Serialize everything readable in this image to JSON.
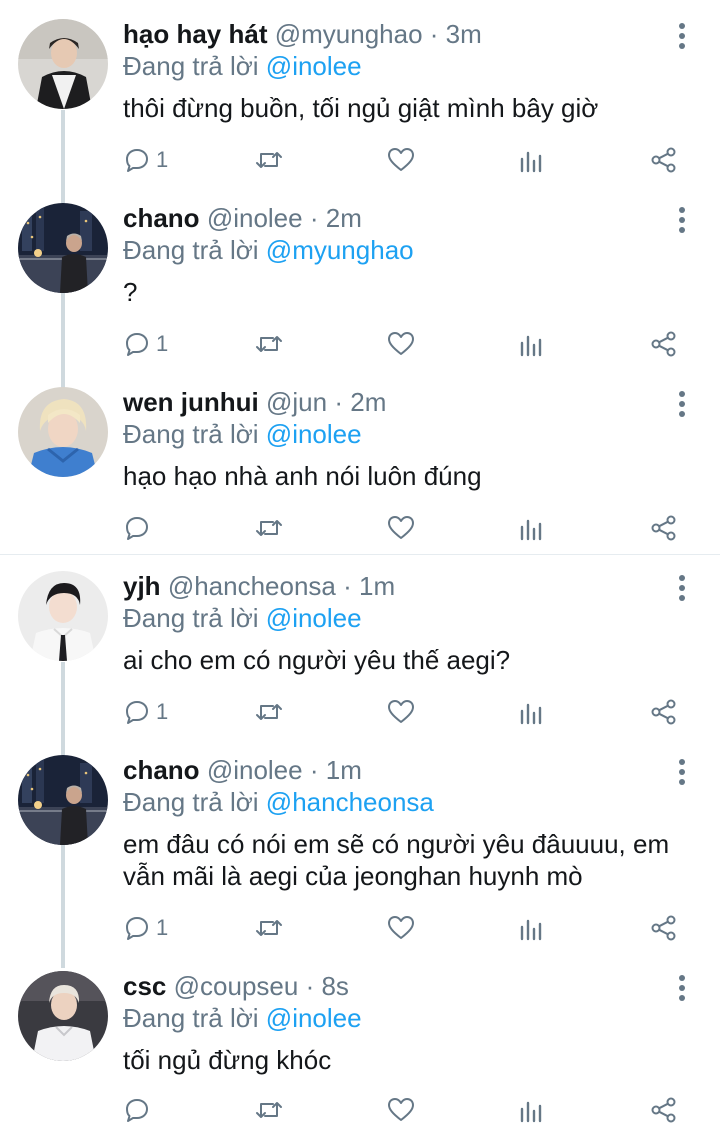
{
  "reply_prefix": "Đang trả lời",
  "tweets": [
    {
      "name": "hạo hay hát",
      "handle": "@myunghao",
      "time": "3m",
      "reply_to": "@inolee",
      "text": "thôi đừng buồn, tối ngủ giật mình bây giờ",
      "reply_count": "1"
    },
    {
      "name": "chano",
      "handle": "@inolee",
      "time": "2m",
      "reply_to": "@myunghao",
      "text": "?",
      "reply_count": "1"
    },
    {
      "name": "wen junhui",
      "handle": "@jun",
      "time": "2m",
      "reply_to": "@inolee",
      "text": "hạo hạo nhà anh nói luôn đúng",
      "reply_count": ""
    },
    {
      "name": "yjh",
      "handle": "@hancheonsa",
      "time": "1m",
      "reply_to": "@inolee",
      "text": "ai cho em có người yêu thế aegi?",
      "reply_count": "1"
    },
    {
      "name": "chano",
      "handle": "@inolee",
      "time": "1m",
      "reply_to": "@hancheonsa",
      "text": "em đâu có nói em sẽ có người yêu đâuuuu, em vẫn mãi là aegi của jeonghan huynh mò",
      "reply_count": "1"
    },
    {
      "name": "csc",
      "handle": "@coupseu",
      "time": "8s",
      "reply_to": "@inolee",
      "text": "tối ngủ đừng khóc",
      "reply_count": ""
    }
  ],
  "icons": {
    "reply": "comment-bubble-icon",
    "retweet": "retweet-icon",
    "like": "heart-icon",
    "analytics": "bar-chart-icon",
    "share": "share-icon",
    "more": "vertical-dots-icon"
  },
  "colors": {
    "mention": "#1da1f2",
    "muted": "#657786",
    "thread_line": "#cfd9de"
  }
}
